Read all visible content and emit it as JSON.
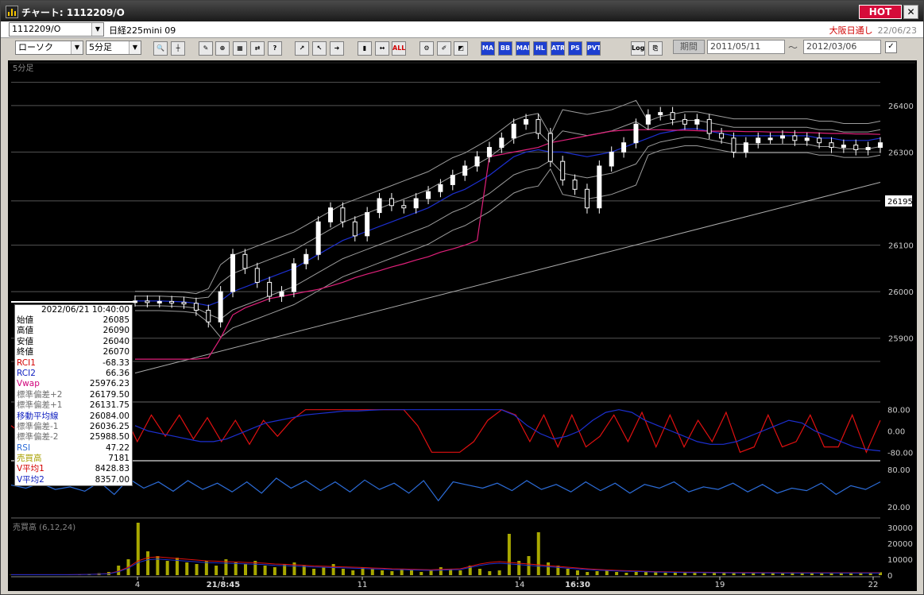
{
  "window": {
    "title": "チャート: 1112209/O",
    "hot_label": "HOT",
    "close_label": "✕"
  },
  "header": {
    "symbol_code": "1112209/O",
    "instrument_name": "日経225mini 09",
    "exchange_label": "大阪日通し",
    "exchange_date": "22/06/23"
  },
  "toolbar": {
    "chart_type": "ローソク",
    "interval": "5分足",
    "buttons": [
      "zoom",
      "crosshair",
      "draw",
      "magnify",
      "grid",
      "compare",
      "info",
      "trend",
      "cursor",
      "arrow",
      "candle",
      "fit",
      "ALL",
      "settings",
      "brush",
      "palette",
      "MA",
      "BB",
      "MAE",
      "HL",
      "ATR",
      "PS",
      "PVT",
      "Log",
      "export"
    ],
    "period_label": "期間",
    "date_from": "2011/05/11",
    "date_to": "2012/03/06",
    "date_sep": "〜",
    "check": "✓"
  },
  "colors": {
    "price": "#ffffff",
    "ma": "#1c2fcf",
    "vwap": "#e0207a",
    "band": "#9c9c9c",
    "rci1": "#e01010",
    "rci2": "#1c2fcf",
    "rsi": "#2c6cd8",
    "volume": "#a8a800"
  },
  "chart_data": {
    "type": "candlestick",
    "title": "5分足",
    "y_axis": {
      "ticks": [
        26400,
        26300,
        26100,
        26000,
        25900
      ],
      "current_price": 26195,
      "range": [
        25780,
        26480
      ]
    },
    "x_axis": {
      "ticks": [
        "4",
        "21/8:45",
        "11",
        "14",
        "16:30",
        "19",
        "22"
      ],
      "bold_ticks": [
        "21/8:45",
        "16:30"
      ]
    },
    "price_series": [
      25980,
      25978,
      25979,
      25977,
      25975,
      25960,
      25935,
      26000,
      26080,
      26050,
      26020,
      25990,
      26000,
      26060,
      26080,
      26150,
      26180,
      26150,
      26120,
      26170,
      26200,
      26185,
      26180,
      26200,
      26215,
      26230,
      26250,
      26270,
      26290,
      26310,
      26330,
      26360,
      26370,
      26340,
      26280,
      26240,
      26220,
      26180,
      26270,
      26300,
      26320,
      26360,
      26380,
      26385,
      26370,
      26360,
      26370,
      26340,
      26330,
      26300,
      26320,
      26330,
      26330,
      26335,
      26325,
      26330,
      26320,
      26310,
      26315,
      26305,
      26310,
      26320
    ],
    "ma_series": [
      25980,
      25980,
      25980,
      25979,
      25978,
      25975,
      25970,
      25980,
      26000,
      26010,
      26020,
      26030,
      26040,
      26050,
      26065,
      26080,
      26095,
      26110,
      26120,
      26130,
      26140,
      26150,
      26160,
      26170,
      26180,
      26195,
      26210,
      26220,
      26235,
      26250,
      26270,
      26290,
      26300,
      26305,
      26300,
      26300,
      26295,
      26290,
      26295,
      26300,
      26310,
      26320,
      26330,
      26340,
      26345,
      26350,
      26350,
      26345,
      26340,
      26335,
      26335,
      26335,
      26335,
      26335,
      26335,
      26335,
      26330,
      26330,
      26325,
      26325,
      26325,
      26330
    ],
    "vwap_series": [
      25855,
      25855,
      25855,
      25855,
      25855,
      25855,
      25858,
      25900,
      25950,
      25965,
      25975,
      25985,
      25990,
      25995,
      26000,
      26005,
      26012,
      26020,
      26030,
      26038,
      26045,
      26053,
      26060,
      26068,
      26075,
      26085,
      26092,
      26100,
      26110,
      26290,
      26295,
      26300,
      26305,
      26310,
      26320,
      26325,
      26330,
      26335,
      26340,
      26345,
      26347,
      26348,
      26348,
      26348,
      26347,
      26347,
      26346,
      26345,
      26345,
      26345,
      26344,
      26344,
      26343,
      26343,
      26342,
      26342,
      26341,
      26340,
      26340,
      26339,
      26339,
      26338
    ],
    "rci_axis": {
      "ticks": [
        "80.00",
        "0.00",
        "-80.00"
      ]
    },
    "rci1_series": [
      20,
      -20,
      40,
      -60,
      30,
      -60,
      60,
      -60,
      70,
      -40,
      60,
      -20,
      60,
      -30,
      50,
      -40,
      40,
      -50,
      40,
      -20,
      40,
      80,
      80,
      80,
      80,
      80,
      80,
      80,
      80,
      20,
      -80,
      -80,
      -80,
      -40,
      40,
      80,
      60,
      -40,
      60,
      -60,
      60,
      -60,
      -20,
      60,
      -40,
      70,
      -60,
      60,
      -60,
      40,
      -40,
      70,
      -80,
      -60,
      60,
      -60,
      -40,
      60,
      -60,
      -60,
      60,
      -80,
      40
    ],
    "rci2_series": [
      20,
      0,
      -10,
      -20,
      -30,
      -40,
      -40,
      -30,
      -10,
      10,
      30,
      40,
      50,
      60,
      65,
      70,
      75,
      75,
      78,
      80,
      80,
      80,
      80,
      80,
      80,
      80,
      80,
      80,
      80,
      60,
      20,
      -10,
      -30,
      -20,
      0,
      40,
      70,
      80,
      70,
      40,
      20,
      0,
      -20,
      -40,
      -50,
      -50,
      -40,
      -20,
      0,
      20,
      40,
      30,
      0,
      -20,
      -40,
      -60,
      -70,
      -75
    ],
    "rsi_axis": {
      "ticks": [
        "80.00",
        "20.00"
      ]
    },
    "rsi_series": [
      55,
      50,
      58,
      48,
      52,
      45,
      60,
      40,
      65,
      50,
      60,
      45,
      62,
      48,
      58,
      44,
      60,
      42,
      66,
      50,
      62,
      46,
      60,
      44,
      63,
      48,
      58,
      42,
      62,
      30,
      60,
      55,
      50,
      58,
      46,
      62,
      48,
      56,
      44,
      60,
      46,
      58,
      42,
      56,
      50,
      60,
      44,
      52,
      48,
      58,
      44,
      56,
      42,
      50,
      46,
      58,
      40,
      54,
      48,
      60
    ],
    "volume_title": "売買高 (6,12,24)",
    "volume_axis": {
      "ticks": [
        "30000",
        "20000",
        "10000",
        "0"
      ]
    },
    "volume_series": [
      200,
      300,
      250,
      200,
      300,
      250,
      200,
      500,
      800,
      1200,
      2000,
      6000,
      10000,
      33000,
      15000,
      12000,
      9000,
      11000,
      8000,
      7000,
      9000,
      6000,
      10000,
      8000,
      7000,
      9000,
      6000,
      5000,
      7000,
      8000,
      6000,
      4000,
      5000,
      7000,
      4000,
      3000,
      5000,
      4000,
      3000,
      2500,
      4000,
      3000,
      2000,
      3500,
      5000,
      4000,
      3000,
      6000,
      4000,
      2500,
      3000,
      26000,
      9000,
      12000,
      27000,
      8000,
      6000,
      4000,
      3000,
      2000,
      2500,
      3000,
      2000,
      1500,
      2000,
      2500,
      1800,
      1500,
      2000,
      1500,
      1800,
      1200,
      1500,
      1300,
      1500,
      1200,
      1500,
      1300,
      1600,
      1200,
      1800,
      1400,
      1500,
      1200,
      1300,
      1400,
      1200,
      1500,
      1300,
      1800
    ],
    "volume_ma_series": [
      300,
      300,
      300,
      300,
      300,
      300,
      320,
      400,
      500,
      700,
      1000,
      2500,
      5000,
      9000,
      11000,
      11500,
      11000,
      10500,
      10000,
      9500,
      9000,
      8800,
      8500,
      8300,
      8000,
      7800,
      7500,
      7000,
      6800,
      6500,
      6200,
      5800,
      5600,
      5400,
      5200,
      5000,
      4800,
      4500,
      4300,
      4000,
      3900,
      3700,
      3500,
      3400,
      3600,
      3800,
      4000,
      5500,
      7000,
      8000,
      8500,
      8000,
      7500,
      7000,
      6500,
      6000,
      5500,
      5000,
      4500,
      4000,
      3600,
      3300,
      3000,
      2800,
      2600,
      2400,
      2200,
      2100,
      2000,
      1900,
      1850,
      1800,
      1750,
      1700,
      1650,
      1600,
      1600,
      1550,
      1550,
      1500,
      1500,
      1500,
      1500,
      1500,
      1500,
      1500,
      1500,
      1500,
      1500,
      1500
    ]
  },
  "info_panel": {
    "timestamp": "2022/06/21  10:40:00",
    "rows": [
      {
        "label": "始値",
        "value": "26085",
        "color": "#000000"
      },
      {
        "label": "高値",
        "value": "26090",
        "color": "#000000"
      },
      {
        "label": "安値",
        "value": "26040",
        "color": "#000000"
      },
      {
        "label": "終値",
        "value": "26070",
        "color": "#000000"
      },
      {
        "label": "RCI1",
        "value": "-68.33",
        "color": "#d40000"
      },
      {
        "label": "RCI2",
        "value": "66.36",
        "color": "#1020c0"
      },
      {
        "label": "Vwap",
        "value": "25976.23",
        "color": "#d0007a"
      },
      {
        "label": "標準偏差+2",
        "value": "26179.50",
        "color": "#707070"
      },
      {
        "label": "標準偏差+1",
        "value": "26131.75",
        "color": "#707070"
      },
      {
        "label": "移動平均線",
        "value": "26084.00",
        "color": "#1020c0"
      },
      {
        "label": "標準偏差-1",
        "value": "26036.25",
        "color": "#707070"
      },
      {
        "label": "標準偏差-2",
        "value": "25988.50",
        "color": "#707070"
      },
      {
        "label": "RSI",
        "value": "47.22",
        "color": "#2c6cd8"
      },
      {
        "label": "売買高",
        "value": "7181",
        "color": "#a8a000"
      },
      {
        "label": "V平均1",
        "value": "8428.83",
        "color": "#d40000"
      },
      {
        "label": "V平均2",
        "value": "8357.00",
        "color": "#1020c0"
      }
    ]
  }
}
